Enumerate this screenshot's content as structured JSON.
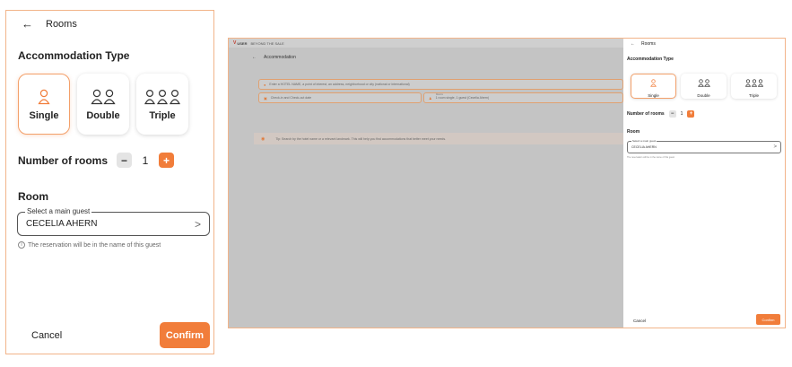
{
  "panel": {
    "back_icon": "arrow-left-icon",
    "title": "Rooms",
    "accommodation_type_title": "Accommodation Type",
    "types": [
      {
        "label": "Single",
        "icon": "person-icon",
        "selected": true
      },
      {
        "label": "Double",
        "icon": "two-persons-icon",
        "selected": false
      },
      {
        "label": "Triple",
        "icon": "three-persons-icon",
        "selected": false
      }
    ],
    "rooms_label": "Number of rooms",
    "rooms_count": "1",
    "minus_label": "−",
    "plus_label": "+",
    "room_section_title": "Room",
    "guest_legend": "Select a main guest",
    "guest_value": "CECELIA AHERN",
    "guest_note": "The reservation will be in the name of this guest",
    "cancel_label": "Cancel",
    "confirm_label": "Confirm"
  },
  "background_app": {
    "brand": "USER",
    "tagline": "BEYOND THE SALE",
    "page_title": "Accommodation",
    "search_placeholder": "Enter a HOTEL NAME, a point of interest, an address, neighborhood or city (national or international)",
    "dates_placeholder": "Check-in and Check-out date",
    "rooms_field_label": "Rooms",
    "rooms_field_value": "1 room single, 1 guest (Cecelia Ahern)",
    "tip_text": "Tip: Search by the hotel name or a relevant landmark. This will help you find accommodations that better meet your needs."
  },
  "colors": {
    "accent": "#f17d3a",
    "border_highlight": "#f2b48a",
    "overlay": "#c4c4c4"
  }
}
